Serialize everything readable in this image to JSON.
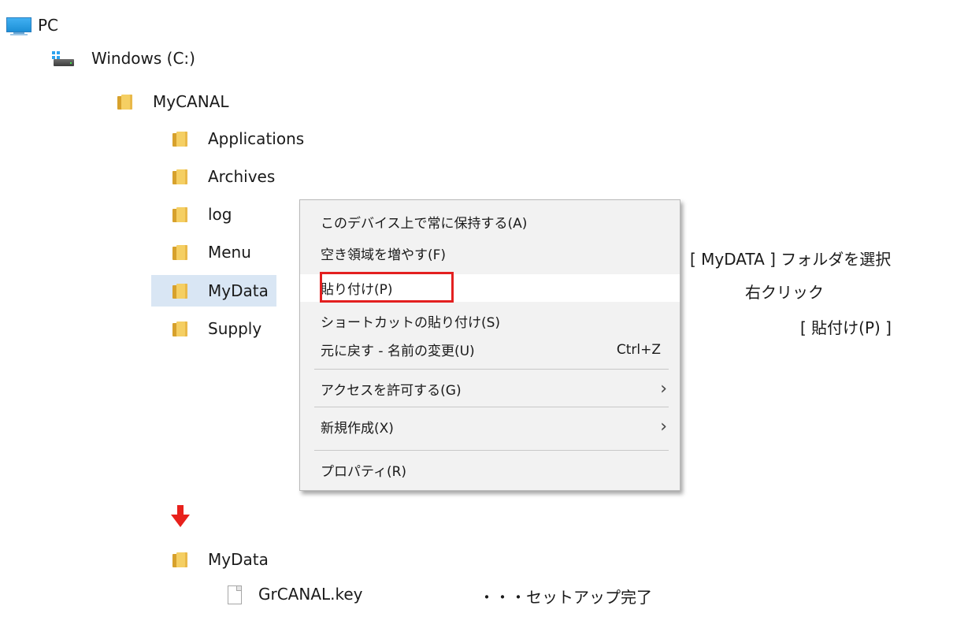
{
  "tree": {
    "pc": "PC",
    "drive": "Windows (C:)",
    "root": "MyCANAL",
    "children": [
      "Applications",
      "Archives",
      "log",
      "Menu",
      "MyData",
      "Supply"
    ]
  },
  "context_menu": {
    "items": [
      {
        "label": "このデバイス上で常に保持する(A)"
      },
      {
        "label": "空き領域を増やす(F)"
      },
      {
        "label": "貼り付け(P)"
      },
      {
        "label": "ショートカットの貼り付け(S)"
      },
      {
        "label": "元に戻す - 名前の変更(U)",
        "shortcut": "Ctrl+Z"
      },
      {
        "label": "アクセスを許可する(G)"
      },
      {
        "label": "新規作成(X)"
      },
      {
        "label": "プロパティ(R)"
      }
    ]
  },
  "notes": {
    "line1": "[ MyDATA ] フォルダを選択",
    "line2": "右クリック",
    "line3": "[ 貼付け(P) ]"
  },
  "result": {
    "folder": "MyData",
    "file": "GrCANAL.key",
    "caption": "・・・セットアップ完了"
  },
  "colors": {
    "selection": "#d9e6f4",
    "highlight_box": "#e32020",
    "arrow": "#e8211c"
  }
}
